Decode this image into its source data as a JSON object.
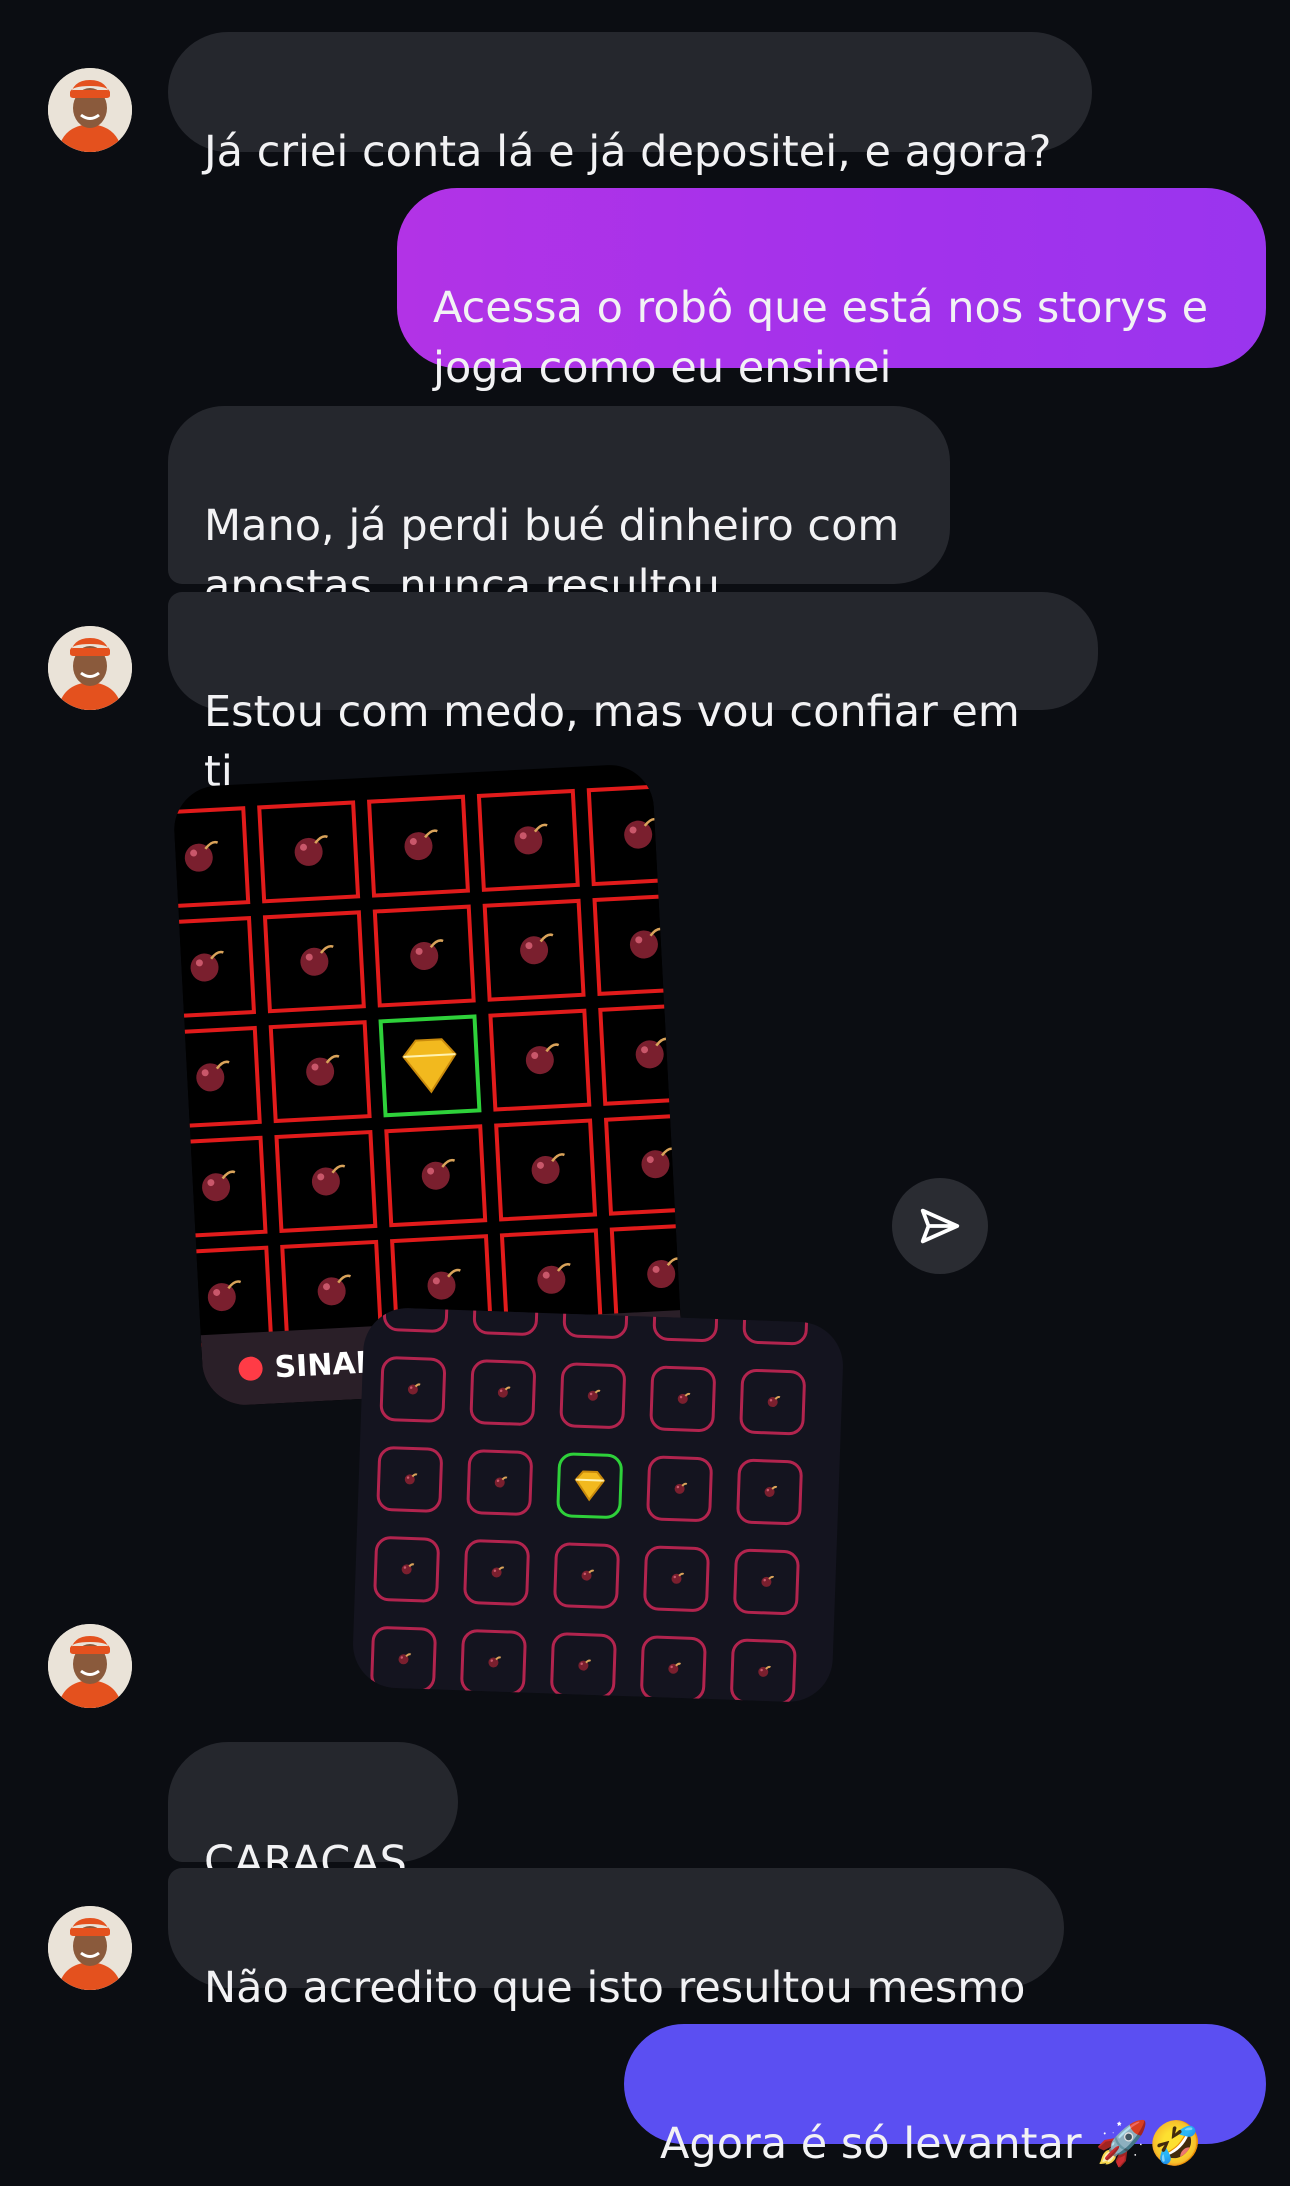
{
  "messages": [
    {
      "id": "m1",
      "sender": "them",
      "text": "Já criei conta lá e já depositei, e agora?"
    },
    {
      "id": "m2",
      "sender": "me",
      "text": "Acessa o robô que está nos storys e\njoga como eu ensinei"
    },
    {
      "id": "m3",
      "sender": "them",
      "text": "Mano, já perdi bué dinheiro com\napostas, nunca resultou"
    },
    {
      "id": "m4",
      "sender": "them",
      "text": "Estou com medo, mas vou confiar em ti"
    },
    {
      "id": "m5",
      "sender": "them",
      "attachment": "stacked-game-screenshots"
    },
    {
      "id": "m6",
      "sender": "them",
      "text": "CARAÇAS"
    },
    {
      "id": "m7",
      "sender": "them",
      "text": "Não acredito que isto resultou mesmo"
    },
    {
      "id": "m8",
      "sender": "me",
      "text": "Agora é só levantar 🚀🤣"
    }
  ],
  "attachment": {
    "caption": "SINAL FI",
    "grid_rows": 5,
    "grid_cols": 5,
    "highlight_cell": "row 3, col 3",
    "cell_icons": [
      "bomb-icon",
      "diamond-icon"
    ]
  },
  "icons": {
    "share": "paper-plane-icon",
    "avatar": "contact-avatar"
  },
  "colors": {
    "background": "#0b0d12",
    "incoming_bubble": "#25272d",
    "outgoing_purple": "#a232ec",
    "outgoing_indigo": "#5b4ff2",
    "grid_red": "#e11b1b",
    "grid_green": "#2ed13a",
    "grid_pink": "#b2244e"
  }
}
